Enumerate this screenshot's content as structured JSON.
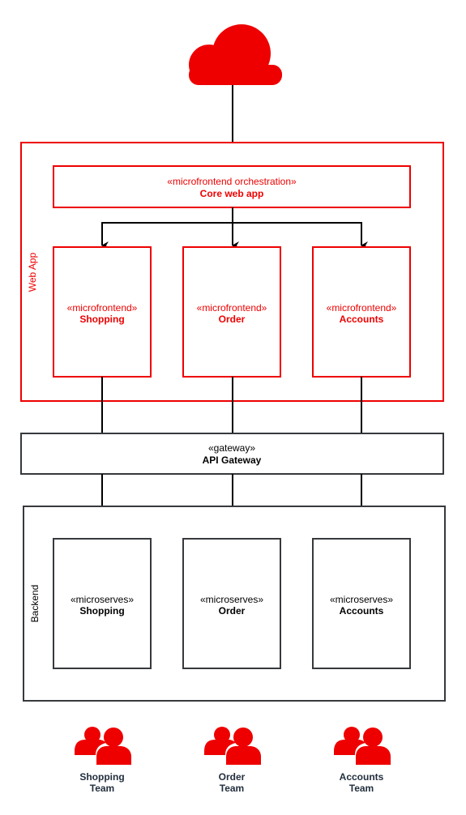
{
  "colors": {
    "accent": "#EE0000",
    "neutral": "#36393d"
  },
  "internet": {
    "icon": "cloud-icon"
  },
  "web_app": {
    "label": "Web App",
    "core": {
      "stereotype": "«microfrontend orchestration»",
      "name": "Core web app"
    },
    "microfrontends": [
      {
        "stereotype": "«microfrontend»",
        "name": "Shopping"
      },
      {
        "stereotype": "«microfrontend»",
        "name": "Order"
      },
      {
        "stereotype": "«microfrontend»",
        "name": "Accounts"
      }
    ]
  },
  "gateway": {
    "stereotype": "«gateway»",
    "name": "API Gateway"
  },
  "backend": {
    "label": "Backend",
    "services": [
      {
        "stereotype": "«microserves»",
        "name": "Shopping"
      },
      {
        "stereotype": "«microserves»",
        "name": "Order"
      },
      {
        "stereotype": "«microserves»",
        "name": "Accounts"
      }
    ]
  },
  "teams": [
    {
      "icon": "users-icon",
      "line1": "Shopping",
      "line2": "Team"
    },
    {
      "icon": "users-icon",
      "line1": "Order",
      "line2": "Team"
    },
    {
      "icon": "users-icon",
      "line1": "Accounts",
      "line2": "Team"
    }
  ]
}
